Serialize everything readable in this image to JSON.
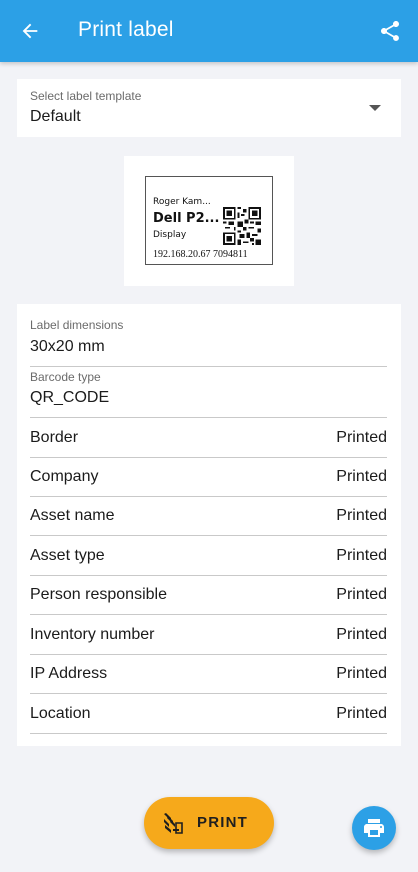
{
  "appbar": {
    "title": "Print label",
    "back_icon": "arrow-left-icon",
    "share_icon": "share-icon",
    "color": "#2ca0e6"
  },
  "template": {
    "label": "Select label template",
    "value": "Default"
  },
  "preview": {
    "line1": "Roger Kam...",
    "line2": "Dell P2...",
    "line3": "Display",
    "line4": "192.168.20.67 7094811"
  },
  "settings": {
    "dimensions": {
      "label": "Label dimensions",
      "value": "30x20 mm"
    },
    "barcode": {
      "label": "Barcode type",
      "value": "QR_CODE"
    },
    "rows": [
      {
        "label": "Border",
        "value": "Printed"
      },
      {
        "label": "Company",
        "value": "Printed"
      },
      {
        "label": "Asset name",
        "value": "Printed"
      },
      {
        "label": "Asset type",
        "value": "Printed"
      },
      {
        "label": "Person responsible",
        "value": "Printed"
      },
      {
        "label": "Inventory number",
        "value": "Printed"
      },
      {
        "label": "IP Address",
        "value": "Printed"
      },
      {
        "label": "Location",
        "value": "Printed"
      }
    ]
  },
  "actions": {
    "print_label": "PRINT",
    "print_icon": "zebra-printer-icon",
    "print_color": "#f6a91b",
    "fab_icon": "printer-icon"
  }
}
